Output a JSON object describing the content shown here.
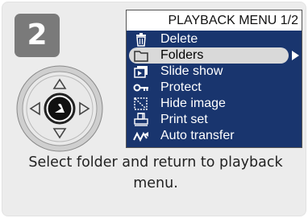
{
  "step": {
    "number": "2"
  },
  "menu": {
    "title": "PLAYBACK MENU 1/2",
    "items": [
      {
        "label": "Delete",
        "icon": "trash-icon"
      },
      {
        "label": "Folders",
        "icon": "folder-icon",
        "selected": true
      },
      {
        "label": "Slide show",
        "icon": "slideshow-icon"
      },
      {
        "label": "Protect",
        "icon": "key-icon"
      },
      {
        "label": "Hide image",
        "icon": "hide-image-icon"
      },
      {
        "label": "Print set",
        "icon": "print-set-icon"
      },
      {
        "label": "Auto transfer",
        "icon": "transfer-icon"
      }
    ]
  },
  "caption": {
    "text": "Select folder and return to playback menu."
  },
  "colors": {
    "lcd_background": "#19356e",
    "highlight": "#d9d9d9",
    "badge": "#7a7a7a"
  }
}
